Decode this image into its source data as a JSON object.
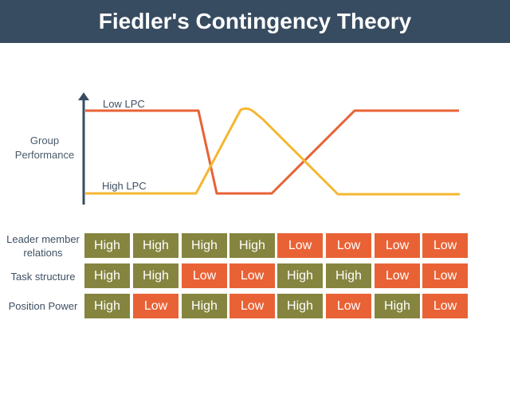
{
  "header": {
    "title": "Fiedler's Contingency Theory"
  },
  "colors": {
    "header_bg": "#374c61",
    "high": "#858540",
    "low": "#e96236",
    "low_lpc_line": "#e96236",
    "high_lpc_line": "#f5b731",
    "axis": "#374c61"
  },
  "chart_data": {
    "type": "line",
    "title": "Fiedler's Contingency Theory",
    "ylabel": "Group Performance",
    "xlabel": "",
    "ylim": [
      0,
      1
    ],
    "x": [
      1,
      2,
      3,
      4,
      5,
      6,
      7,
      8
    ],
    "series": [
      {
        "name": "Low LPC",
        "label": "Low LPC",
        "values": [
          1,
          1,
          0,
          0,
          0.5,
          1,
          1,
          1
        ]
      },
      {
        "name": "High LPC",
        "label": "High LPC",
        "values": [
          0,
          0,
          1,
          0.8,
          0.3,
          0,
          0,
          0
        ]
      }
    ]
  },
  "table": {
    "rows": [
      {
        "label": "Leader member relations",
        "values": [
          "High",
          "High",
          "High",
          "High",
          "Low",
          "Low",
          "Low",
          "Low"
        ]
      },
      {
        "label": "Task structure",
        "values": [
          "High",
          "High",
          "Low",
          "Low",
          "High",
          "High",
          "Low",
          "Low"
        ]
      },
      {
        "label": "Position Power",
        "values": [
          "High",
          "Low",
          "High",
          "Low",
          "High",
          "Low",
          "High",
          "Low"
        ]
      }
    ]
  }
}
